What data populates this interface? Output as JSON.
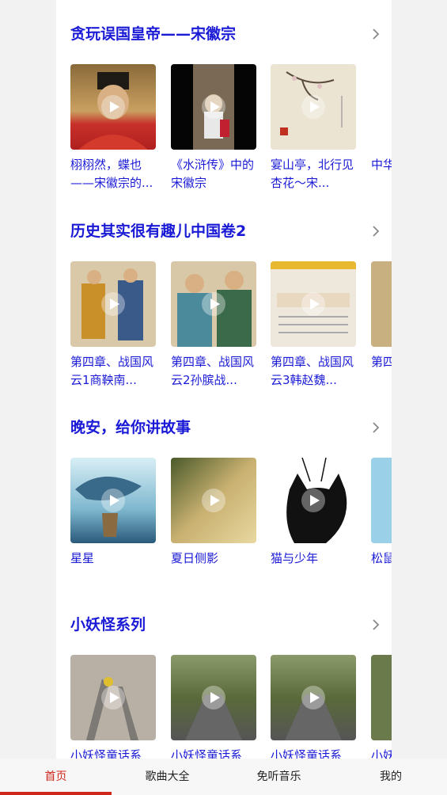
{
  "sections": [
    {
      "title": "贪玩误国皇帝——宋徽宗",
      "cards": [
        {
          "title": "栩栩然，蝶也——宋徽宗的..."
        },
        {
          "title": "《水浒传》中的宋徽宗"
        },
        {
          "title": "宴山亭，北行见杏花～宋..."
        },
        {
          "title": "中华年一"
        }
      ]
    },
    {
      "title": "历史其实很有趣儿中国卷2",
      "cards": [
        {
          "title": "第四章、战国风云1商鞅南..."
        },
        {
          "title": "第四章、战国风云2孙膑战..."
        },
        {
          "title": "第四章、战国风云3韩赵魏..."
        },
        {
          "title": "第四风云"
        }
      ]
    },
    {
      "title": "晚安，给你讲故事",
      "cards": [
        {
          "title": "星星"
        },
        {
          "title": "夏日侧影"
        },
        {
          "title": "猫与少年"
        },
        {
          "title": "松鼠"
        }
      ]
    },
    {
      "title": "小妖怪系列",
      "cards": [
        {
          "title": "小妖怪童话系"
        },
        {
          "title": "小妖怪童话系"
        },
        {
          "title": "小妖怪童话系"
        },
        {
          "title": "小妖"
        }
      ]
    }
  ],
  "tabs": [
    {
      "label": "首页"
    },
    {
      "label": "歌曲大全"
    },
    {
      "label": "免听音乐"
    },
    {
      "label": "我的"
    }
  ]
}
